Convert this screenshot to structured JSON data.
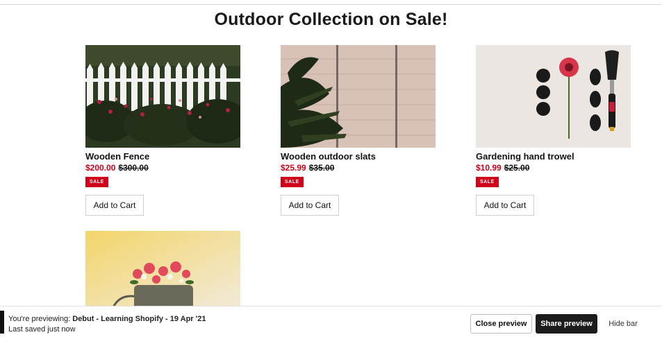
{
  "page": {
    "title": "Outdoor Collection on Sale!"
  },
  "products": [
    {
      "name": "Wooden Fence",
      "price": "$200.00",
      "compare_price": "$300.00",
      "badge": "SALE",
      "button": "Add to Cart",
      "image": "white-picket-fence-with-flowers"
    },
    {
      "name": "Wooden outdoor slats",
      "price": "$25.99",
      "compare_price": "$35.00",
      "badge": "SALE",
      "button": "Add to Cart",
      "image": "wood-slat-wall-with-plant"
    },
    {
      "name": "Gardening hand trowel",
      "price": "$10.99",
      "compare_price": "$25.00",
      "badge": "SALE",
      "button": "Add to Cart",
      "image": "flatlay-trowel-flower-stones"
    },
    {
      "name": "",
      "price": "",
      "compare_price": "",
      "badge": "",
      "button": "",
      "image": "watering-can-with-flowers"
    }
  ],
  "preview_bar": {
    "prefix": "You're previewing: ",
    "theme": "Debut - Learning Shopify - 19 Apr '21",
    "saved": "Last saved just now",
    "close_label": "Close preview",
    "share_label": "Share preview",
    "hide_label": "Hide bar"
  },
  "colors": {
    "sale": "#d0021b",
    "dark_button": "#1c1c1c",
    "border": "#cfcfcf"
  }
}
